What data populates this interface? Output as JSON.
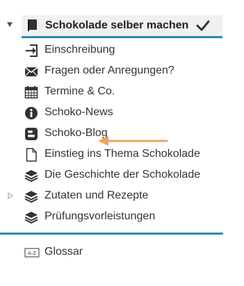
{
  "course": {
    "title": "Schokolade selber machen",
    "collapse_icon": "triangle-down-icon",
    "book_icon": "book-icon",
    "check_icon": "checkmark-icon"
  },
  "nav_items": [
    {
      "label": "Einschreibung",
      "icon": "enrollment-icon"
    },
    {
      "label": "Fragen oder Anregungen?",
      "icon": "envelope-icon"
    },
    {
      "label": "Termine & Co.",
      "icon": "calendar-icon"
    },
    {
      "label": "Schoko-News",
      "icon": "info-icon"
    },
    {
      "label": "Schoko-Blog",
      "icon": "blog-icon"
    },
    {
      "label": "Einstieg ins Thema Schokolade",
      "icon": "document-icon"
    },
    {
      "label": "Die Geschichte der Schokolade",
      "icon": "layers-icon"
    },
    {
      "label": "Zutaten und Rezepte",
      "icon": "layers-icon",
      "expandable": true
    },
    {
      "label": "Prüfungsvorleistungen",
      "icon": "layers-icon"
    }
  ],
  "footer_items": [
    {
      "label": "Glossar",
      "icon": "glossary-icon"
    }
  ],
  "colors": {
    "accent": "#1f8fa7",
    "annotation_arrow": "#f0a35e",
    "root_background": "#f0f0f0"
  }
}
